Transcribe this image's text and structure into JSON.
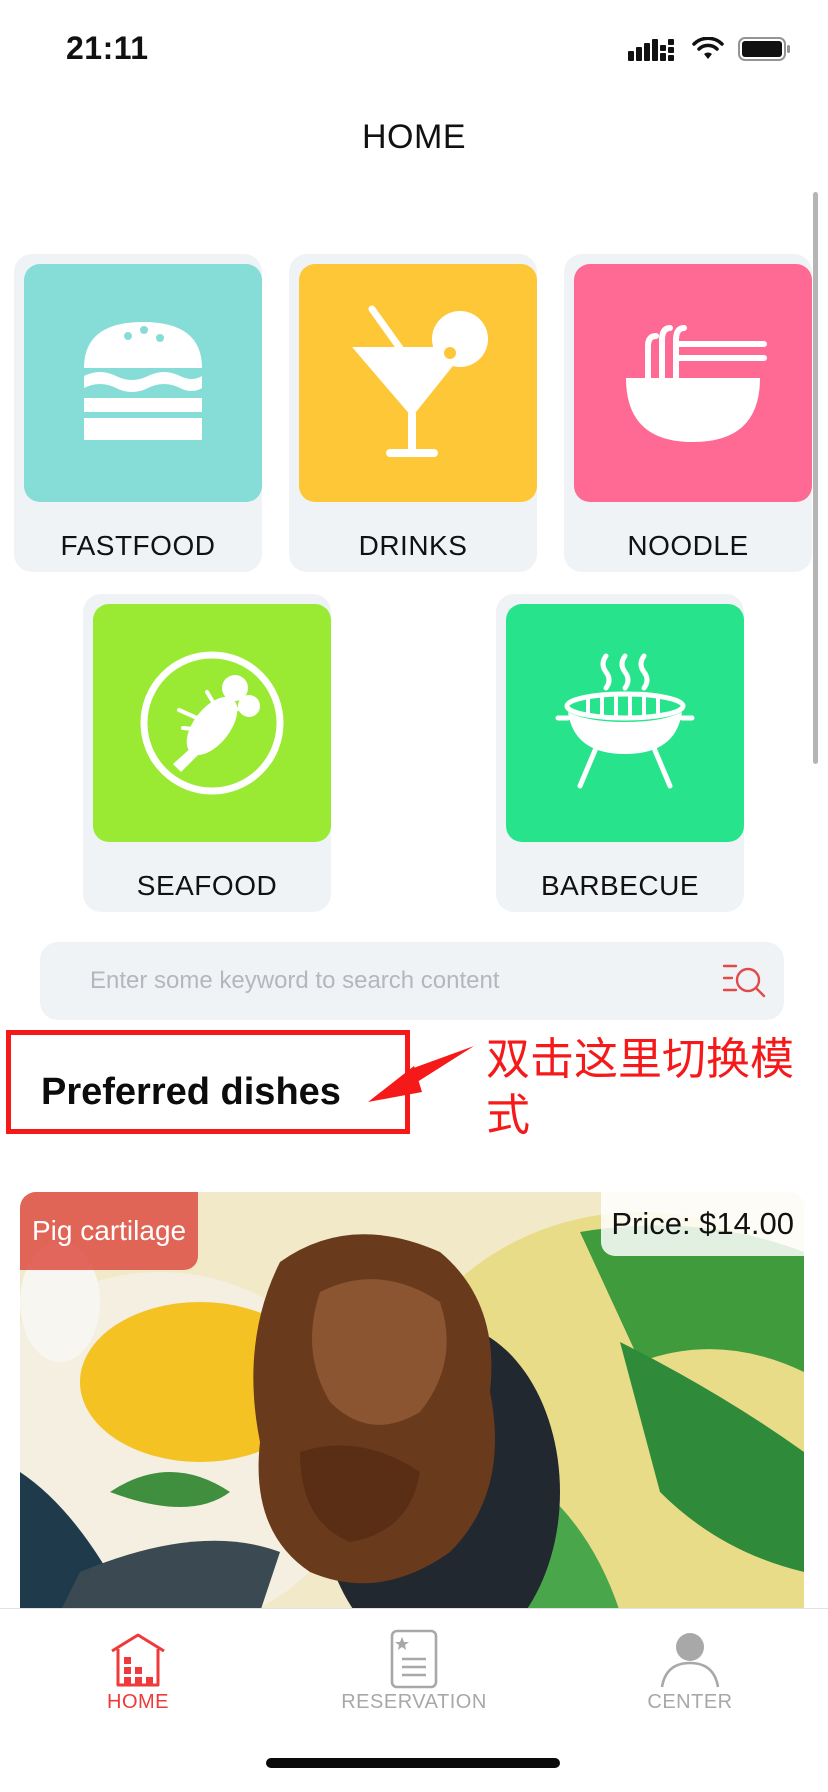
{
  "status_bar": {
    "time": "21:11",
    "icons": [
      "signal-icon",
      "wifi-icon",
      "battery-icon"
    ]
  },
  "header": {
    "title": "HOME"
  },
  "categories": [
    {
      "label": "FASTFOOD",
      "icon": "burger-icon",
      "color": "#86ddd7"
    },
    {
      "label": "DRINKS",
      "icon": "cocktail-icon",
      "color": "#fec737"
    },
    {
      "label": "NOODLE",
      "icon": "noodle-bowl-icon",
      "color": "#ff6a94"
    },
    {
      "label": "SEAFOOD",
      "icon": "lobster-icon",
      "color": "#9aea33"
    },
    {
      "label": "BARBECUE",
      "icon": "grill-icon",
      "color": "#27e48c"
    }
  ],
  "search": {
    "placeholder": "Enter some keyword to search content",
    "value": ""
  },
  "section": {
    "title": "Preferred dishes"
  },
  "annotation": {
    "text": "双击这里切换模式"
  },
  "dishes": [
    {
      "name": "Pig cartilage",
      "price": "Price: $14.00"
    }
  ],
  "tab_bar": {
    "active": "HOME",
    "active_color": "#ee3a3a",
    "inactive_color": "#a8a8a8",
    "items": [
      {
        "label": "HOME",
        "icon": "home-building-icon"
      },
      {
        "label": "RESERVATION",
        "icon": "reservation-document-icon"
      },
      {
        "label": "CENTER",
        "icon": "user-profile-icon"
      }
    ]
  }
}
